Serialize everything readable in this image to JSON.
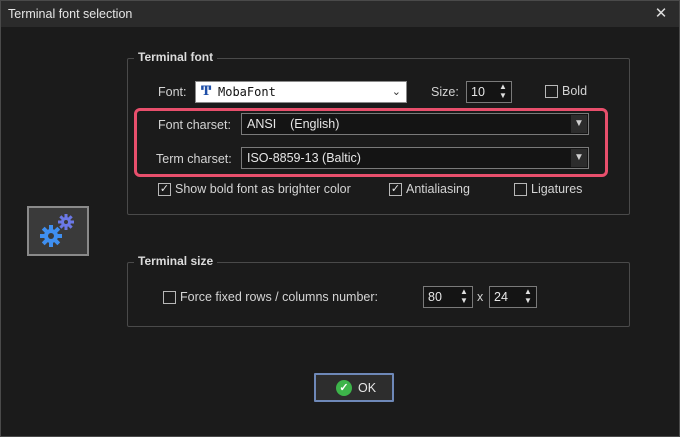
{
  "window": {
    "title": "Terminal font selection"
  },
  "terminal_font": {
    "legend": "Terminal font",
    "font_label": "Font:",
    "font_value": "MobaFont",
    "font_icon": "truetype-icon",
    "size_label": "Size:",
    "size_value": "10",
    "bold_label": "Bold",
    "bold_checked": false,
    "font_charset_label": "Font charset:",
    "font_charset_value": "ANSI    (English)",
    "term_charset_label": "Term charset:",
    "term_charset_value": "ISO-8859-13 (Baltic)",
    "bright_label": "Show bold font as brighter color",
    "bright_checked": true,
    "antialias_label": "Antialiasing",
    "antialias_checked": true,
    "ligatures_label": "Ligatures",
    "ligatures_checked": false
  },
  "terminal_size": {
    "legend": "Terminal size",
    "force_label": "Force fixed rows / columns number:",
    "force_checked": false,
    "rows_value": "80",
    "separator": "x",
    "cols_value": "24"
  },
  "buttons": {
    "ok_label": "OK"
  },
  "colors": {
    "highlight": "#e84f6c",
    "ok_icon": "#3db44a",
    "gear_icon": "#5b8de8"
  }
}
